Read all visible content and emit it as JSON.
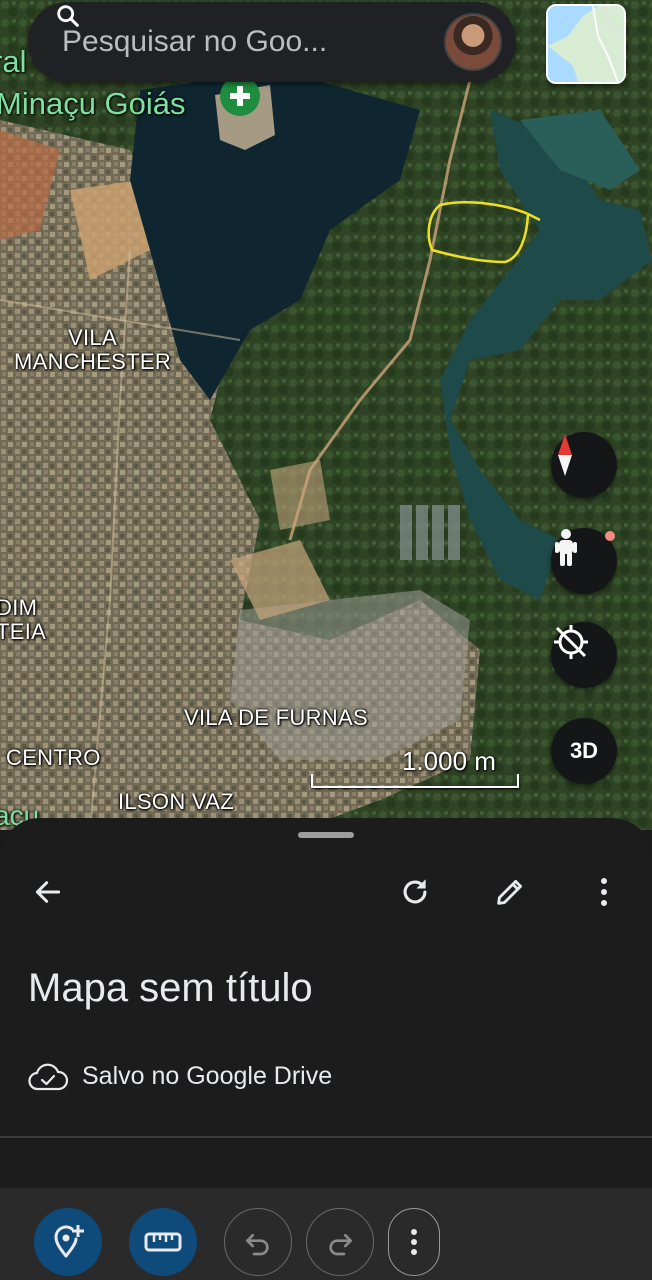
{
  "search": {
    "placeholder": "Pesquisar no Goo..."
  },
  "map": {
    "city_label": "Minaçu Goiás",
    "city_partial_top": "ral",
    "place_labels": {
      "vila_manchester": "VILA\nMANCHESTER",
      "jardim_ateia": "DIM\nTEIA",
      "vila_de_furnas": "VILA DE FURNAS",
      "centro": "CENTRO",
      "ilson_vaz": "ILSON VAZ",
      "bottom_partial": "açu"
    },
    "scale": "1.000 m",
    "three_d_label": "3D"
  },
  "sheet": {
    "title": "Mapa sem título",
    "save_status": "Salvo no Google Drive"
  },
  "icons": {
    "search": "search-icon",
    "back": "arrow-back-icon",
    "refresh": "refresh-icon",
    "edit": "pencil-icon",
    "more": "more-vert-icon",
    "cloud": "cloud-done-icon",
    "add_place": "add-location-icon",
    "measure": "ruler-icon",
    "undo": "undo-icon",
    "redo": "redo-icon",
    "compass": "compass-icon",
    "pegman": "pegman-icon",
    "location": "location-off-icon"
  },
  "colors": {
    "accent_blue": "#0e4a7a",
    "drawn_polygon": "#f0e020",
    "city_label": "#7ee0a0",
    "compass_red": "#e53935"
  }
}
